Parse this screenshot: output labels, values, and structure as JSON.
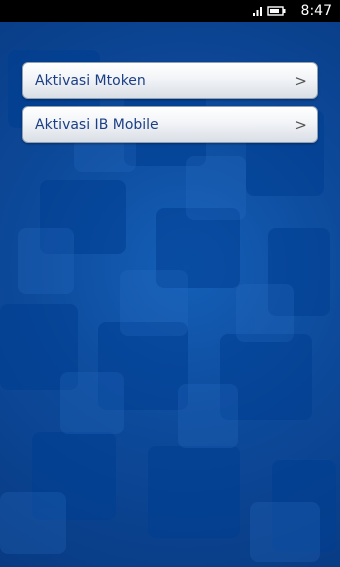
{
  "status_bar": {
    "time": "8:47",
    "icons": [
      "wifi-icon",
      "battery-icon"
    ]
  },
  "menu": {
    "items": [
      {
        "label": "Aktivasi Mtoken",
        "chevron": ">"
      },
      {
        "label": "Aktivasi IB Mobile",
        "chevron": ">"
      }
    ]
  },
  "colors": {
    "background": "#0b3f8f",
    "button_text": "#1b3f86",
    "status_bar": "#000000"
  }
}
